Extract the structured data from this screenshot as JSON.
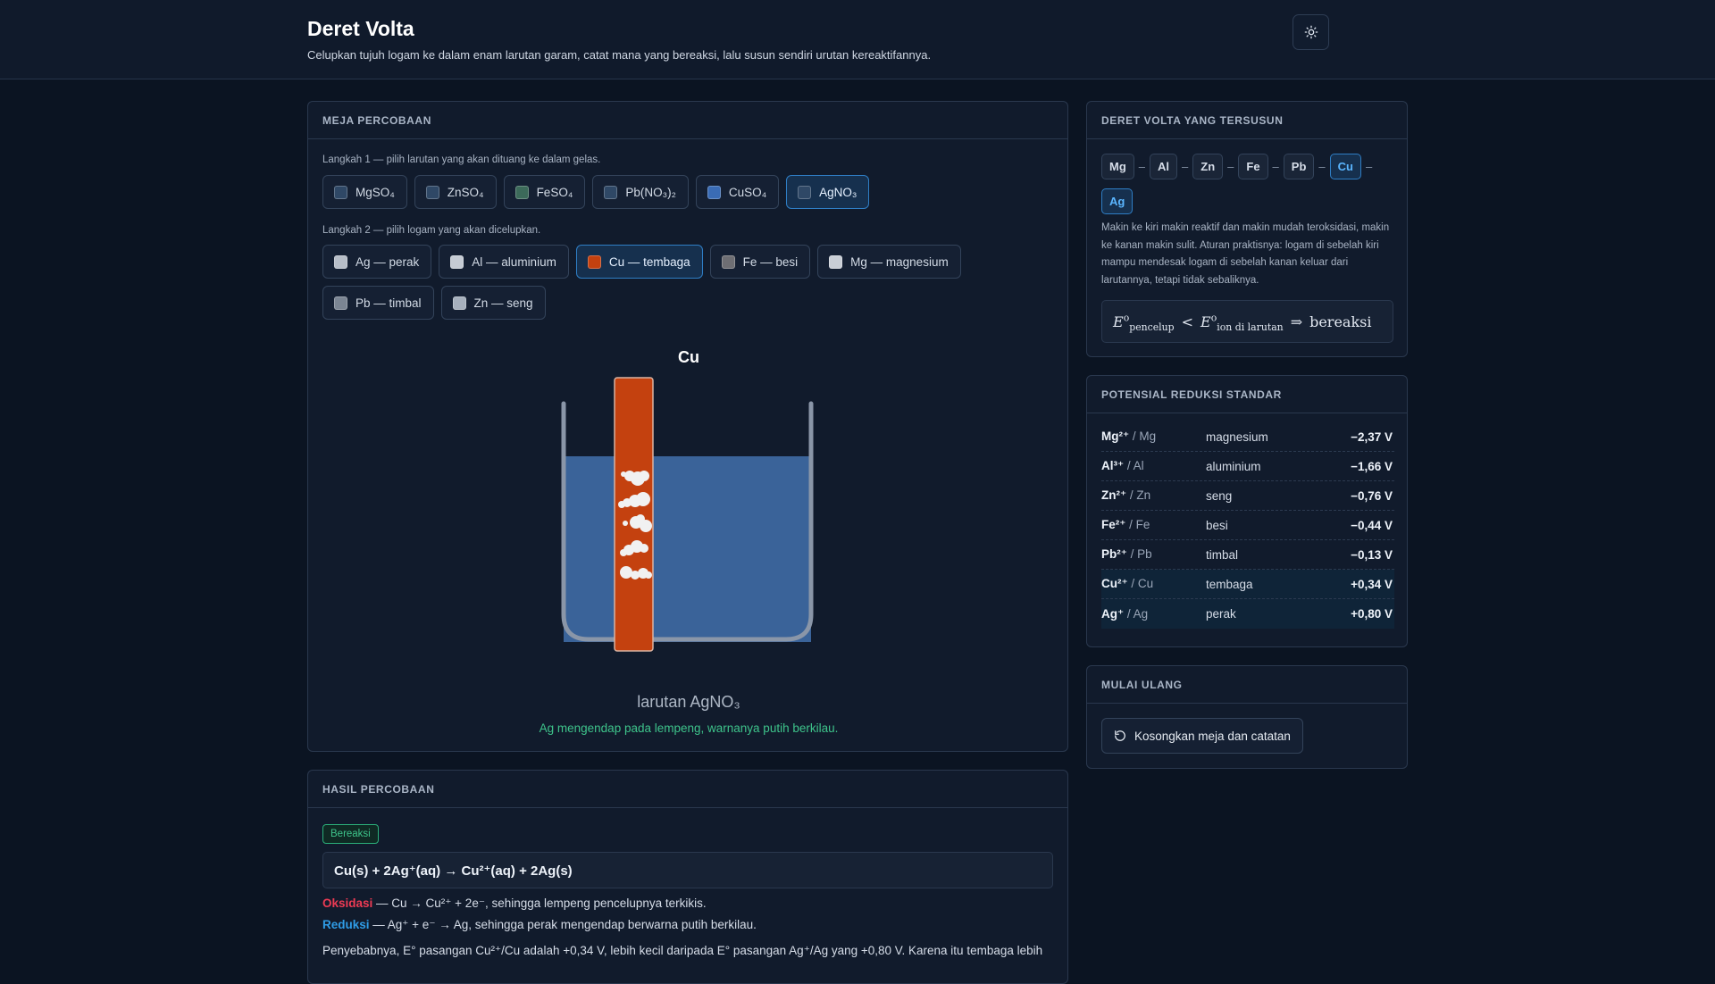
{
  "header": {
    "title": "Deret Volta",
    "subtitle": "Celupkan tujuh logam ke dalam enam larutan garam, catat mana yang bereaksi, lalu susun sendiri urutan kereaktifannya."
  },
  "lab": {
    "heading": "Meja Percobaan",
    "step1": "Langkah 1 — pilih larutan yang akan dituang ke dalam gelas.",
    "step2": "Langkah 2 — pilih logam yang akan dicelupkan.",
    "solutions": [
      {
        "label": "MgSO₄",
        "color": "#2f4866",
        "selected": false
      },
      {
        "label": "ZnSO₄",
        "color": "#2f4866",
        "selected": false
      },
      {
        "label": "FeSO₄",
        "color": "#3c6a5a",
        "selected": false
      },
      {
        "label": "Pb(NO₃)₂",
        "color": "#2f4866",
        "selected": false
      },
      {
        "label": "CuSO₄",
        "color": "#3a6cb5",
        "selected": false
      },
      {
        "label": "AgNO₃",
        "color": "#2f4866",
        "selected": true
      }
    ],
    "metals": [
      {
        "label": "Ag — perak",
        "color": "#b7bec8",
        "selected": false
      },
      {
        "label": "Al — aluminium",
        "color": "#c5cbd4",
        "selected": false
      },
      {
        "label": "Cu — tembaga",
        "color": "#c4410f",
        "selected": true
      },
      {
        "label": "Fe — besi",
        "color": "#6e6e73",
        "selected": false
      },
      {
        "label": "Mg — magnesium",
        "color": "#c9ced6",
        "selected": false
      },
      {
        "label": "Pb — timbal",
        "color": "#7b8593",
        "selected": false
      },
      {
        "label": "Zn — seng",
        "color": "#a6b0bd",
        "selected": false
      }
    ],
    "dipped_metal": "Cu",
    "solution_caption": "larutan AgNO₃",
    "observation": "Ag mengendap pada lempeng, warnanya putih berkilau.",
    "colors": {
      "solution": "#3a6399",
      "metal": "#c4410f",
      "glass": "#8a96a8"
    }
  },
  "result": {
    "heading": "Hasil Percobaan",
    "badge": "Bereaksi",
    "equation": "Cu(s) + 2Ag⁺(aq) → Cu²⁺(aq) + 2Ag(s)",
    "oxidation_label": "Oksidasi",
    "oxidation_text": " — Cu → Cu²⁺ + 2e⁻, sehingga lempeng pencelupnya terkikis.",
    "reduction_label": "Reduksi",
    "reduction_text": " — Ag⁺ + e⁻ → Ag, sehingga perak mengendap berwarna putih berkilau.",
    "reason": "Penyebabnya, E° pasangan Cu²⁺/Cu adalah +0,34 V, lebih kecil daripada E° pasangan Ag⁺/Ag yang +0,80 V. Karena itu tembaga lebih"
  },
  "series": {
    "heading": "Deret Volta yang Tersusun",
    "metals": [
      {
        "symbol": "Mg",
        "highlight": false
      },
      {
        "symbol": "Al",
        "highlight": false
      },
      {
        "symbol": "Zn",
        "highlight": false
      },
      {
        "symbol": "Fe",
        "highlight": false
      },
      {
        "symbol": "Pb",
        "highlight": false
      },
      {
        "symbol": "Cu",
        "highlight": true
      },
      {
        "symbol": "Ag",
        "highlight": true
      }
    ],
    "separator": "–",
    "note": "Makin ke kiri makin reaktif dan makin mudah teroksidasi, makin ke kanan makin sulit. Aturan praktisnya: logam di sebelah kiri mampu mendesak logam di sebelah kanan keluar dari larutannya, tetapi tidak sebaliknya.",
    "rule_lhs_sub": "pencelup",
    "rule_rhs_sub": "ion di larutan",
    "rule_result": "bereaksi"
  },
  "potentials": {
    "heading": "Potensial Reduksi Standar",
    "rows": [
      {
        "ion": "Mg²⁺",
        "metal": " / Mg",
        "name": "magnesium",
        "value": "−2,37 V",
        "highlight": false
      },
      {
        "ion": "Al³⁺",
        "metal": " / Al",
        "name": "aluminium",
        "value": "−1,66 V",
        "highlight": false
      },
      {
        "ion": "Zn²⁺",
        "metal": " / Zn",
        "name": "seng",
        "value": "−0,76 V",
        "highlight": false
      },
      {
        "ion": "Fe²⁺",
        "metal": " / Fe",
        "name": "besi",
        "value": "−0,44 V",
        "highlight": false
      },
      {
        "ion": "Pb²⁺",
        "metal": " / Pb",
        "name": "timbal",
        "value": "−0,13 V",
        "highlight": false
      },
      {
        "ion": "Cu²⁺",
        "metal": " / Cu",
        "name": "tembaga",
        "value": "+0,34 V",
        "highlight": true
      },
      {
        "ion": "Ag⁺",
        "metal": " / Ag",
        "name": "perak",
        "value": "+0,80 V",
        "highlight": true
      }
    ]
  },
  "reset": {
    "heading": "Mulai Ulang",
    "button": "Kosongkan meja dan catatan"
  }
}
